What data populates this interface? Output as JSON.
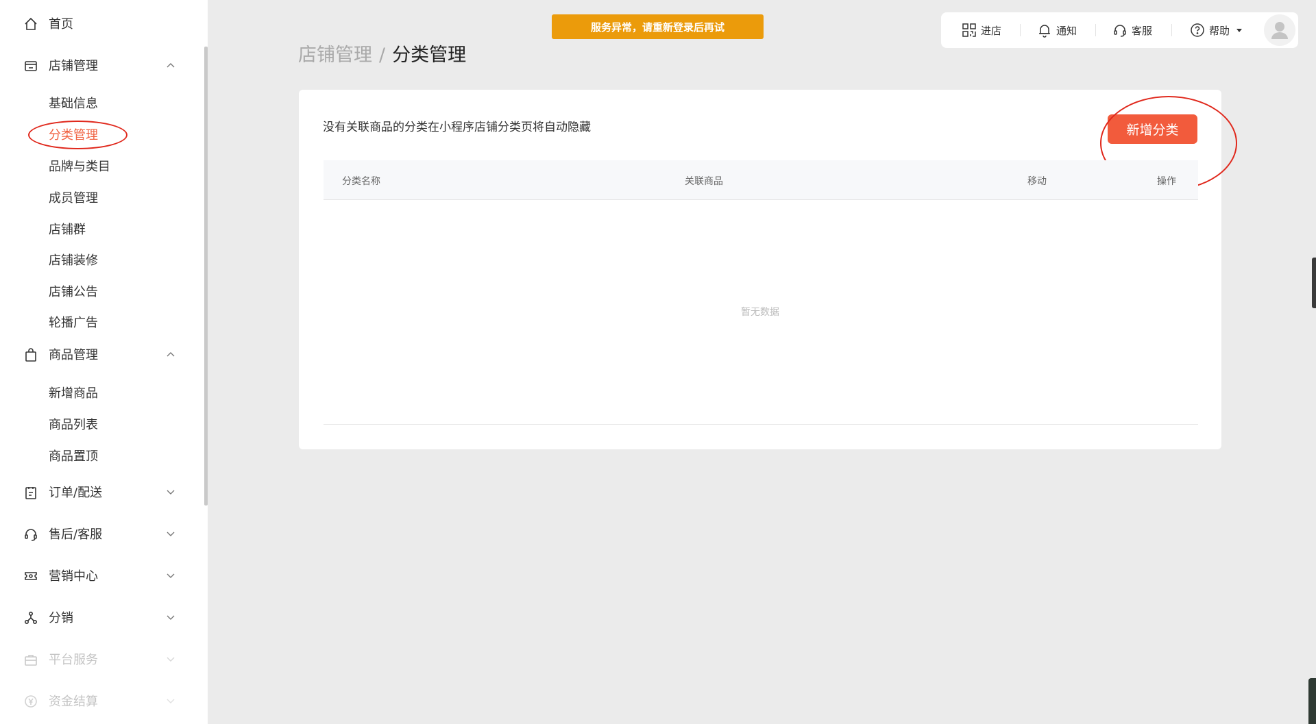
{
  "sidebar": {
    "home": "首页",
    "store_mgmt": "店铺管理",
    "store_sub": [
      "基础信息",
      "分类管理",
      "品牌与类目",
      "成员管理",
      "店铺群",
      "店铺装修",
      "店铺公告",
      "轮播广告"
    ],
    "goods_mgmt": "商品管理",
    "goods_sub": [
      "新增商品",
      "商品列表",
      "商品置顶"
    ],
    "orders": "订单/配送",
    "after_sale": "售后/客服",
    "marketing": "营销中心",
    "distribution": "分销",
    "platform": "平台服务",
    "settlement": "资金结算"
  },
  "banner": "服务异常，请重新登录后再试",
  "topbar": {
    "enter_store": "进店",
    "notify": "通知",
    "service": "客服",
    "help": "帮助"
  },
  "breadcrumb": {
    "parent": "店铺管理",
    "current": "分类管理"
  },
  "card": {
    "hint": "没有关联商品的分类在小程序店铺分类页将自动隐藏",
    "add_button": "新增分类",
    "columns": [
      "分类名称",
      "关联商品",
      "移动",
      "操作"
    ],
    "empty_text": "暂无数据"
  },
  "colors": {
    "accent": "#f25b3c",
    "active_text": "#f0603f",
    "banner_bg": "#eb9b0b",
    "annotation": "#e0281c"
  }
}
